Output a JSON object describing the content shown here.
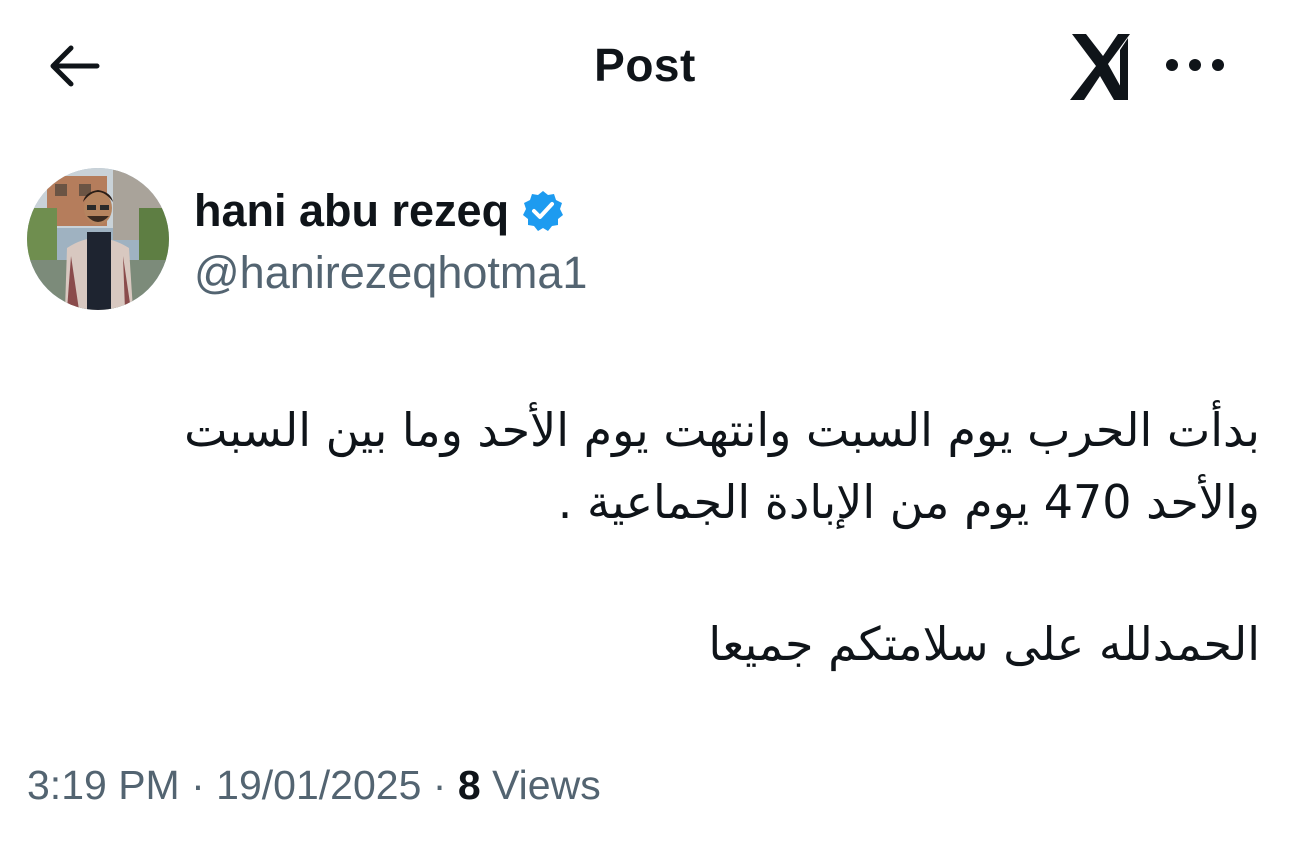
{
  "header": {
    "title": "Post",
    "back_icon": "arrow-left-icon",
    "grok_icon": "grok-logo-icon",
    "more_icon": "more-horizontal-icon"
  },
  "author": {
    "name": "hani abu rezeq",
    "handle": "@hanirezeqhotma1",
    "verified": true,
    "verified_color": "#1d9bf0"
  },
  "post": {
    "lines": [
      "بدأت الحرب يوم السبت وانتهت يوم الأحد وما بين السبت",
      "والأحد 470 يوم من الإبادة الجماعية .",
      "الحمدلله على سلامتكم جميعا"
    ]
  },
  "meta": {
    "time": "3:19 PM",
    "separator": "·",
    "date": "19/01/2025",
    "views_count": "8",
    "views_label": "Views"
  }
}
